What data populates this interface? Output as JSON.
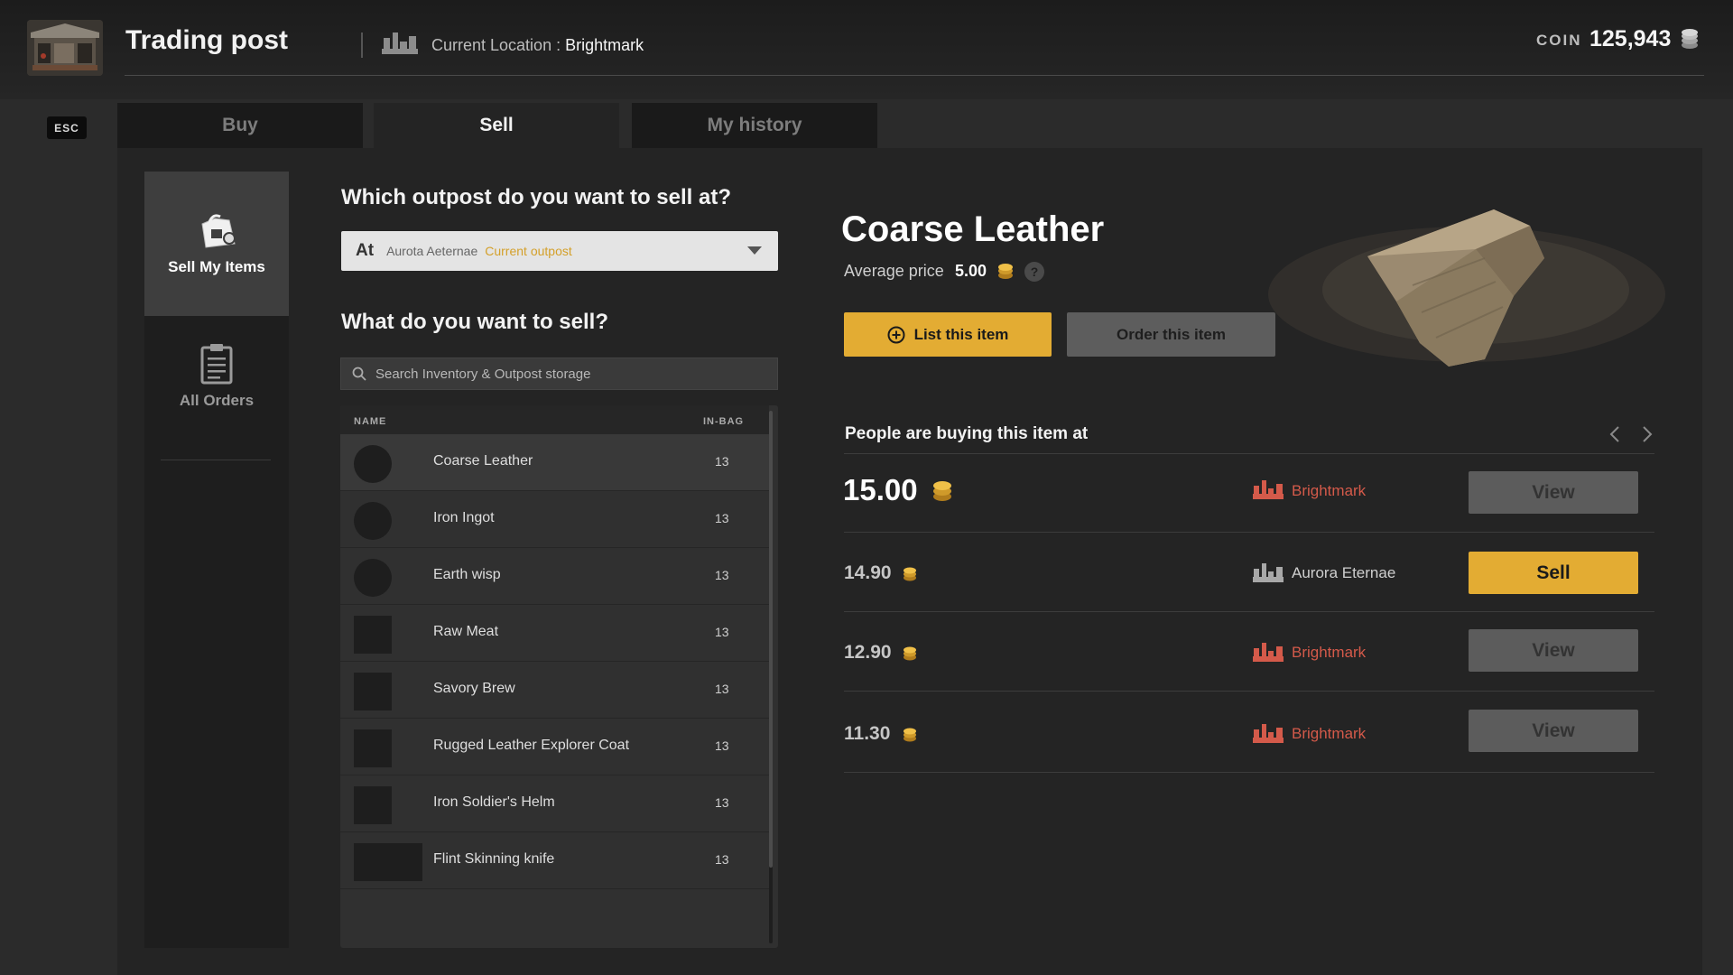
{
  "header": {
    "title": "Trading post",
    "location_label": "Current Location : ",
    "location_value": "Brightmark",
    "coin_label": "COIN",
    "coin_value": "125,943"
  },
  "esc_label": "ESC",
  "tabs": [
    {
      "label": "Buy",
      "active": false
    },
    {
      "label": "Sell",
      "active": true
    },
    {
      "label": "My history",
      "active": false
    }
  ],
  "sidebar": {
    "items": [
      {
        "label": "Sell My Items",
        "icon": "bag-icon",
        "active": true
      },
      {
        "label": "All Orders",
        "icon": "clipboard-icon",
        "active": false
      }
    ]
  },
  "outpost": {
    "question": "Which outpost do you want to sell at?",
    "prefix": "At",
    "selected": "Aurota Aeternae",
    "badge": "Current outpost"
  },
  "sell_question": "What do you want to sell?",
  "search": {
    "placeholder": "Search Inventory & Outpost storage"
  },
  "inventory": {
    "headers": {
      "name": "NAME",
      "bag": "IN-BAG"
    },
    "rows": [
      {
        "name": "Coarse Leather",
        "count": "13"
      },
      {
        "name": "Iron Ingot",
        "count": "13"
      },
      {
        "name": "Earth wisp",
        "count": "13"
      },
      {
        "name": "Raw Meat",
        "count": "13"
      },
      {
        "name": "Savory Brew",
        "count": "13"
      },
      {
        "name": "Rugged Leather Explorer Coat",
        "count": "13"
      },
      {
        "name": "Iron Soldier's Helm",
        "count": "13"
      },
      {
        "name": "Flint Skinning knife",
        "count": "13"
      }
    ]
  },
  "item": {
    "name": "Coarse Leather",
    "avg_label": "Average price",
    "avg_value": "5.00",
    "help": "?",
    "list_label": "List this item",
    "order_label": "Order this item"
  },
  "buying": {
    "title": "People are buying this item at",
    "offers": [
      {
        "price": "15.00",
        "location": "Brightmark",
        "button": "View"
      },
      {
        "price": "14.90",
        "location": "Aurora Eternae",
        "button": "Sell"
      },
      {
        "price": "12.90",
        "location": "Brightmark",
        "button": "View"
      },
      {
        "price": "11.30",
        "location": "Brightmark",
        "button": "View"
      }
    ]
  },
  "colors": {
    "accent": "#e3ac33",
    "location_red": "#d45a4a",
    "panel": "#242424"
  }
}
